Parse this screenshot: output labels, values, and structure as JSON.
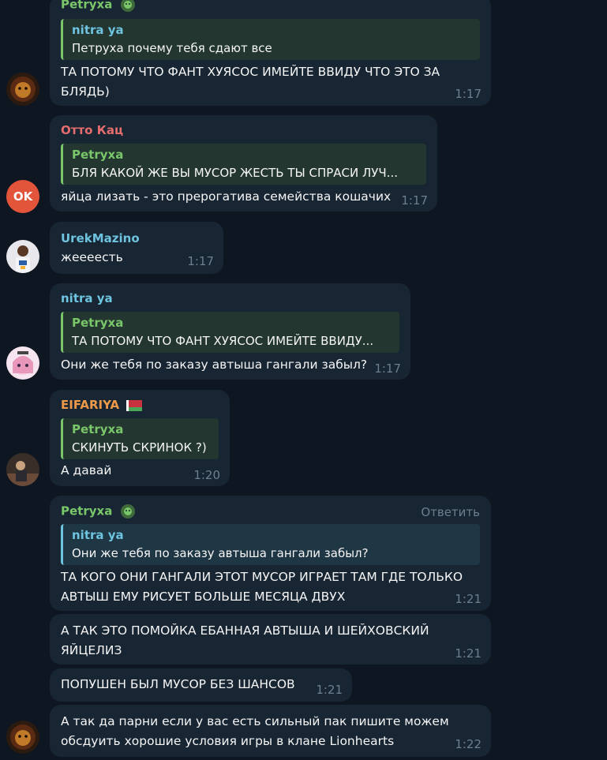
{
  "messages": [
    {
      "name": "Petryxa",
      "quote_name": "nitra ya",
      "quote_text": "Петруха почему тебя сдают все",
      "text": "ТА ПОТОМУ ЧТО ФАНТ ХУЯСОС ИМЕЙТЕ ВВИДУ ЧТО ЭТО ЗА БЛЯДЬ)",
      "time": "1:17"
    },
    {
      "name": "Отто Кац",
      "quote_name": "Petryxa",
      "quote_text": "БЛЯ КАКОЙ ЖЕ ВЫ МУСОР ЖЕСТЬ ТЫ СПРАСИ ЛУЧ...",
      "text": "яйца лизать - это прерогатива семейства кошачих",
      "time": "1:17",
      "avatar_text": "OK"
    },
    {
      "name": "UrekMazino",
      "text": "жеееесть",
      "time": "1:17"
    },
    {
      "name": "nitra ya",
      "quote_name": "Petryxa",
      "quote_text": "ТА ПОТОМУ ЧТО ФАНТ ХУЯСОС ИМЕЙТЕ ВВИДУ...",
      "text": "Они же тебя по заказу автыша гангали забыл?",
      "time": "1:17"
    },
    {
      "name": "EIFARIYA",
      "quote_name": "Petryxa",
      "quote_text": "СКИНУТЬ СКРИНОК ?)",
      "text": "А давай",
      "time": "1:20"
    },
    {
      "name": "Petryxa",
      "reply_label": "Ответить",
      "quote_name": "nitra ya",
      "quote_text": "Они же тебя по заказу автыша гангали забыл?",
      "text": "ТА КОГО ОНИ ГАНГАЛИ ЭТОТ МУСОР ИГРАЕТ ТАМ ГДЕ ТОЛЬКО АВТЫШ ЕМУ РИСУЕТ БОЛЬШЕ МЕСЯЦА ДВУХ",
      "time": "1:21"
    },
    {
      "text": "А ТАК ЭТО ПОМОЙКА ЕБАННАЯ АВТЫША И ШЕЙХОВСКИЙ ЯЙЦЕЛИЗ",
      "time": "1:21"
    },
    {
      "text": "ПОПУШЕН БЫЛ МУСОР БЕЗ ШАНСОВ",
      "time": "1:21"
    },
    {
      "text": "А так да парни если у вас есть сильный пак пишите можем обсдуить хорошие условия игры в клане Lionhearts",
      "time": "1:22"
    }
  ],
  "colors": {
    "background": "#0e1621",
    "bubble": "#182533",
    "green": "#7ac76a",
    "blue": "#6ec3df",
    "red": "#e56d6d",
    "orange": "#ec9a4a",
    "time": "#6d7f8f"
  },
  "icons": {
    "badge": "lion-badge-icon",
    "flag": "belarus-flag-icon"
  }
}
